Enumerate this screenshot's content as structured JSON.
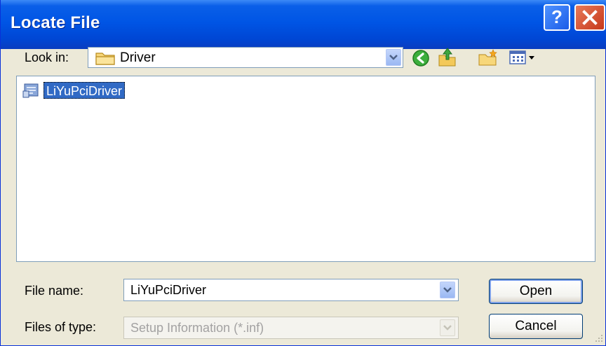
{
  "window": {
    "title": "Locate File",
    "help_glyph": "?",
    "help_button_icon": "help-icon",
    "close_button_icon": "close-icon"
  },
  "toolbar": {
    "look_in_label": "Look in:",
    "look_in_value": "Driver",
    "look_in_icon": "folder-icon",
    "buttons": [
      "back-icon",
      "up-folder-icon",
      "new-folder-icon",
      "view-menu-icon"
    ]
  },
  "file_list": {
    "items": [
      {
        "name": "LiYuPciDriver",
        "icon": "setup-file-icon",
        "selected": true
      }
    ]
  },
  "fields": {
    "file_name_label": "File name:",
    "file_name_value": "LiYuPciDriver",
    "file_type_label": "Files of type:",
    "file_type_value": "Setup Information (*.inf)"
  },
  "buttons": {
    "open_label": "Open",
    "cancel_label": "Cancel"
  },
  "colors": {
    "titlebar": "#0055e5",
    "selection": "#316ac5",
    "dialog_bg": "#ece9d8"
  }
}
